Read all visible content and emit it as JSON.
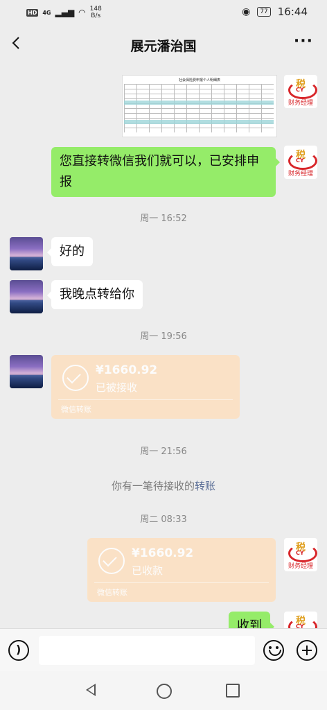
{
  "status_bar": {
    "hd": "HD",
    "network": "4G",
    "speed_value": "148",
    "speed_unit": "B/s",
    "battery": "77",
    "time": "16:44"
  },
  "header": {
    "title": "展元潘治国",
    "more": "···"
  },
  "contact_logo": {
    "glyph": "税",
    "mark": "CY",
    "caption": "财务经理"
  },
  "shared_document": {
    "title": "社会保险费申报个人明细表"
  },
  "messages": [
    {
      "text": "您直接转微信我们就可以，已安排申报"
    },
    {
      "text": "好的"
    },
    {
      "text": "我晚点转给你"
    },
    {
      "text": "收到"
    }
  ],
  "timestamps": [
    "周一 16:52",
    "周一 19:56",
    "周一 21:56",
    "周二 08:33"
  ],
  "transfers": [
    {
      "amount": "¥1660.92",
      "status": "已被接收",
      "footer": "微信转账"
    },
    {
      "amount": "¥1660.92",
      "status": "已收款",
      "footer": "微信转账"
    }
  ],
  "system_note": {
    "text": "你有一笔待接收的",
    "link": "转账"
  }
}
